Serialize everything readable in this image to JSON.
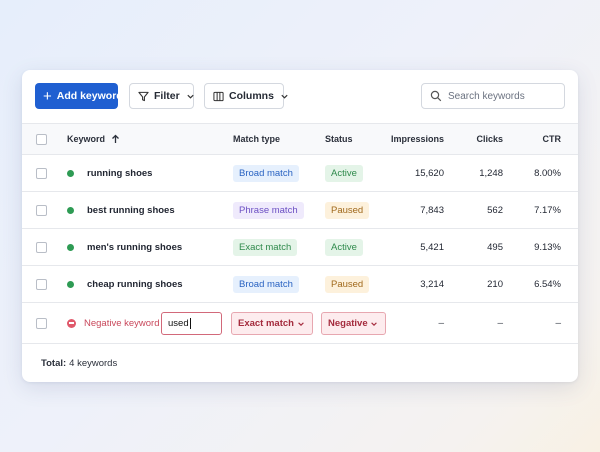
{
  "toolbar": {
    "add_label": "Add keyword",
    "filter_label": "Filter",
    "columns_label": "Columns",
    "search_placeholder": "Search keywords"
  },
  "table": {
    "headers": {
      "keyword": "Keyword",
      "match_type": "Match type",
      "status": "Status",
      "impressions": "Impressions",
      "clicks": "Clicks",
      "ctr": "CTR"
    },
    "sort_icon": "arrow-up-icon",
    "rows": [
      {
        "keyword": "running shoes",
        "match_type": "Broad match",
        "status": "Active",
        "impressions": "15,620",
        "clicks": "1,248",
        "ctr": "8.00%"
      },
      {
        "keyword": "best running shoes",
        "match_type": "Phrase match",
        "status": "Paused",
        "impressions": "7,843",
        "clicks": "562",
        "ctr": "7.17%"
      },
      {
        "keyword": "men's running shoes",
        "match_type": "Exact match",
        "status": "Active",
        "impressions": "5,421",
        "clicks": "495",
        "ctr": "9.13%"
      },
      {
        "keyword": "cheap running shoes",
        "match_type": "Broad match",
        "status": "Paused",
        "impressions": "3,214",
        "clicks": "210",
        "ctr": "6.54%"
      }
    ],
    "negative_row": {
      "label": "Negative keyword",
      "input_value": "used",
      "match_type": "Exact match",
      "status": "Negative",
      "impressions": "–",
      "clicks": "–",
      "ctr": "–"
    }
  },
  "footer": {
    "total_label": "Total:",
    "total_value": "4 keywords"
  },
  "colors": {
    "primary": "#1f5fd1",
    "active_dot": "#2e9b54",
    "negative": "#c9495c"
  }
}
